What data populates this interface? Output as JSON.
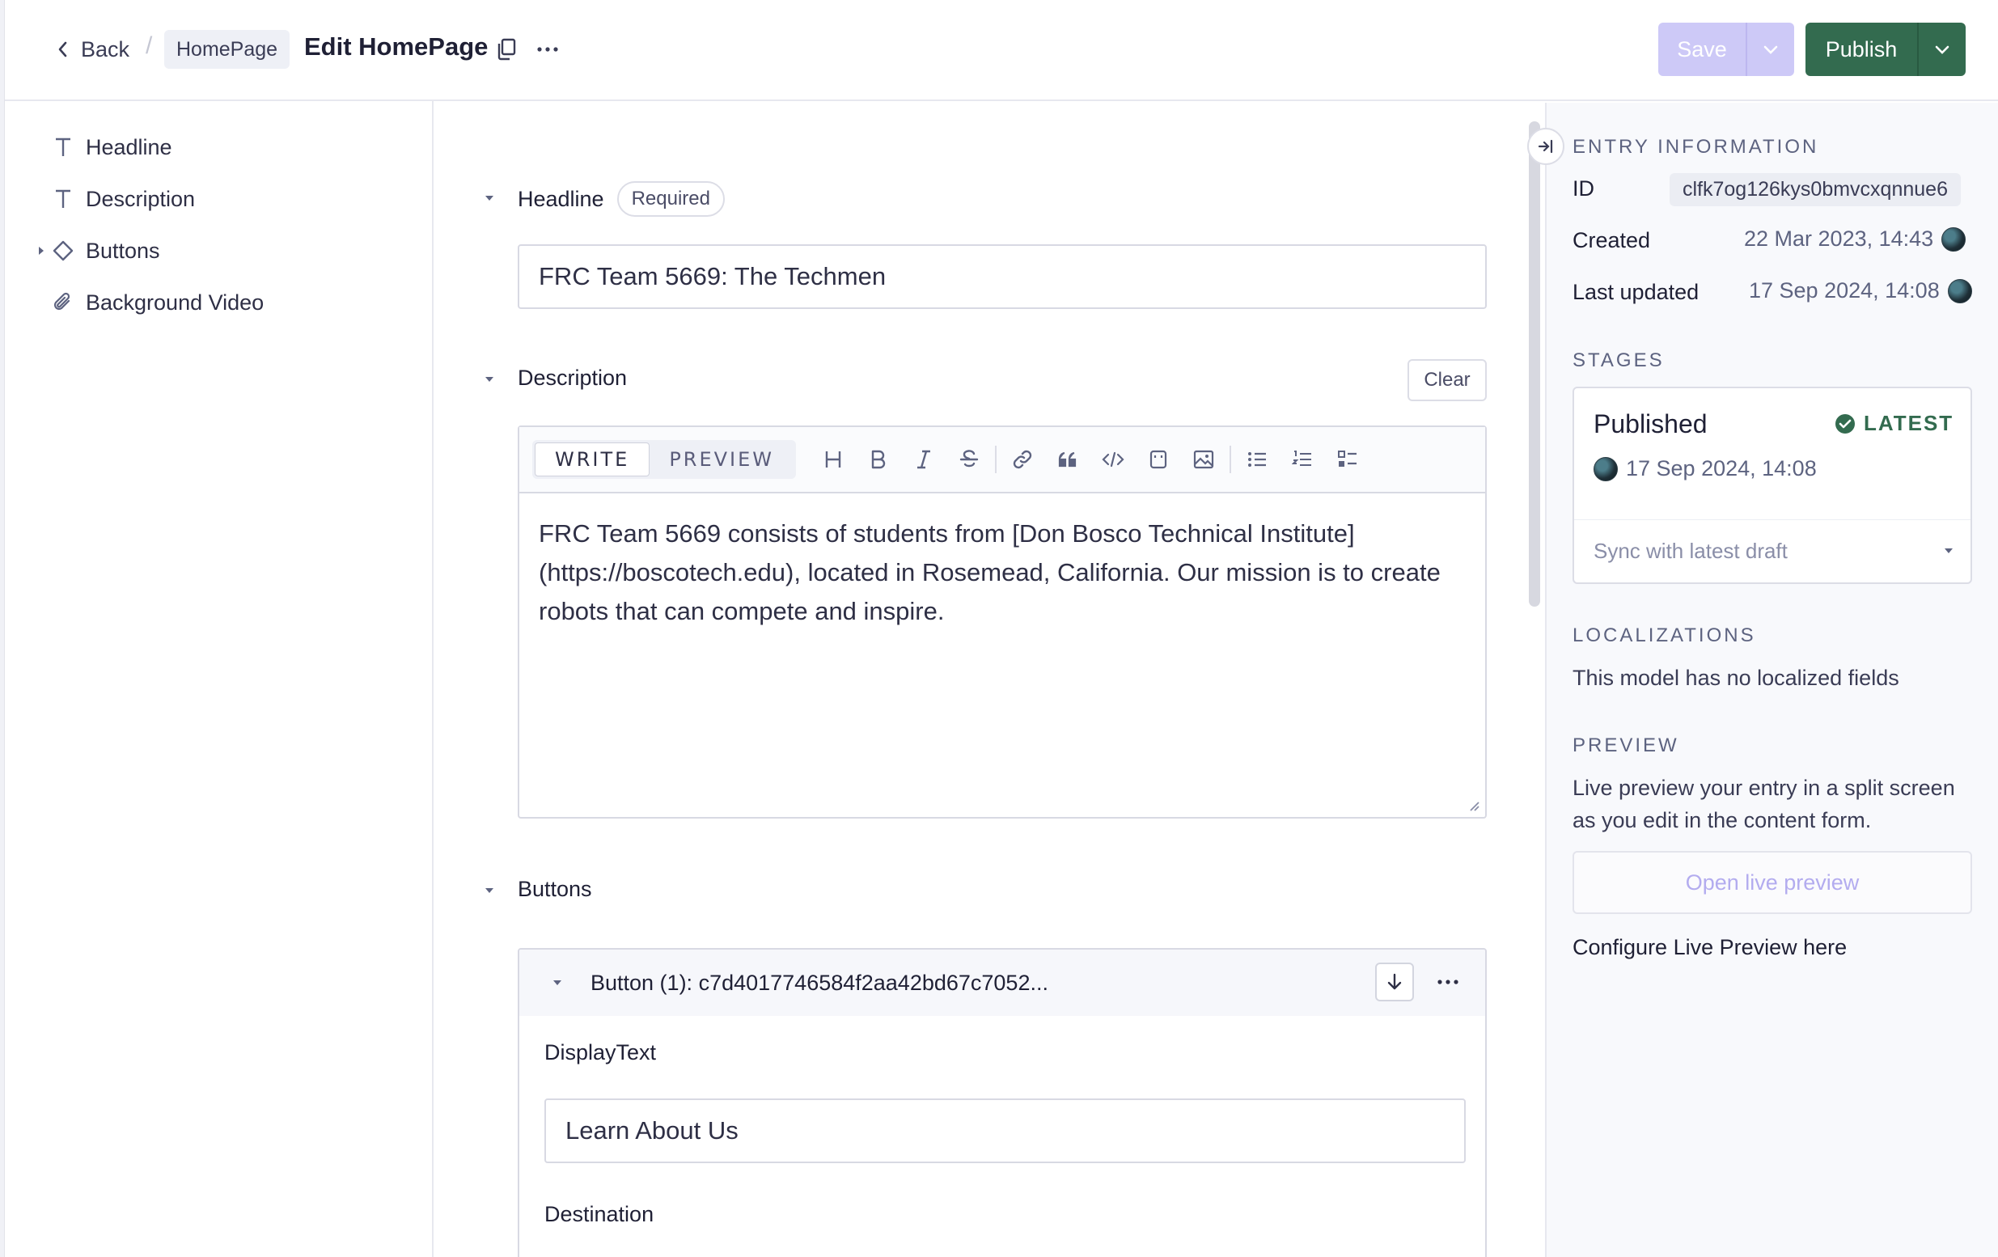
{
  "header": {
    "back_label": "Back",
    "breadcrumb": "HomePage",
    "title": "Edit HomePage",
    "save_label": "Save",
    "publish_label": "Publish",
    "publish_color": "#336b4f",
    "save_color": "#cdc9f7"
  },
  "fieldnav": {
    "items": [
      {
        "label": "Headline",
        "icon": "text-icon"
      },
      {
        "label": "Description",
        "icon": "text-icon"
      },
      {
        "label": "Buttons",
        "icon": "component-icon"
      },
      {
        "label": "Background Video",
        "icon": "attachment-icon"
      }
    ]
  },
  "fields": {
    "headline": {
      "label": "Headline",
      "badge": "Required",
      "value": "FRC Team 5669: The Techmen"
    },
    "description": {
      "label": "Description",
      "clear_label": "Clear",
      "mode_write": "WRITE",
      "mode_preview": "PREVIEW",
      "value": "FRC Team 5669 consists of students from [Don Bosco Technical Institute](https://boscotech.edu), located in Rosemead, California. Our mission is to create robots that can compete and inspire."
    },
    "buttons": {
      "label": "Buttons",
      "card_title": "Button (1): c7d4017746584f2aa42bd67c7052...",
      "display_text_label": "DisplayText",
      "display_text_value": "Learn About Us",
      "destination_label": "Destination"
    }
  },
  "sidebar": {
    "entry_info_title": "ENTRY INFORMATION",
    "id_label": "ID",
    "id_value": "clfk7og126kys0bmvcxqnnue6",
    "created_label": "Created",
    "created_value": "22 Mar 2023, 14:43",
    "updated_label": "Last updated",
    "updated_value": "17 Sep 2024, 14:08",
    "stages_title": "STAGES",
    "stage_name": "Published",
    "stage_badge": "LATEST",
    "stage_time": "17 Sep 2024, 14:08",
    "sync_label": "Sync with latest draft",
    "localizations_title": "LOCALIZATIONS",
    "localizations_text": "This model has no localized fields",
    "preview_title": "PREVIEW",
    "preview_text": "Live preview your entry in a split screen as you edit in the content form.",
    "open_preview_label": "Open live preview",
    "configure_label": "Configure Live Preview here"
  }
}
